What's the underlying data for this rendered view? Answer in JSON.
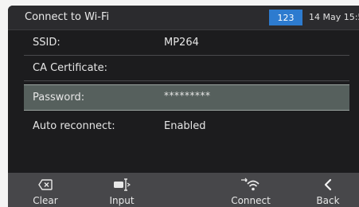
{
  "header": {
    "title": "Connect to Wi-Fi",
    "mode_badge": "123",
    "clock": "14 May 15:5"
  },
  "form": {
    "rows": [
      {
        "label": "SSID:",
        "value": "MP264"
      },
      {
        "label": "CA Certificate:",
        "value": ""
      },
      {
        "label": "Password:",
        "value": "*********",
        "selected": true
      },
      {
        "label": "Auto reconnect:",
        "value": "Enabled"
      }
    ]
  },
  "softkeys": [
    {
      "label": "Clear",
      "icon": "backspace-icon"
    },
    {
      "label": "Input",
      "icon": "input-method-icon"
    },
    {
      "label": "Connect",
      "icon": "wifi-connect-icon"
    },
    {
      "label": "Back",
      "icon": "chevron-left-icon"
    }
  ],
  "colors": {
    "accent": "#2d7bcf",
    "screen_bg": "#1c1c1e",
    "softkey_bg": "#47474a",
    "selected_row": "#56605d"
  }
}
